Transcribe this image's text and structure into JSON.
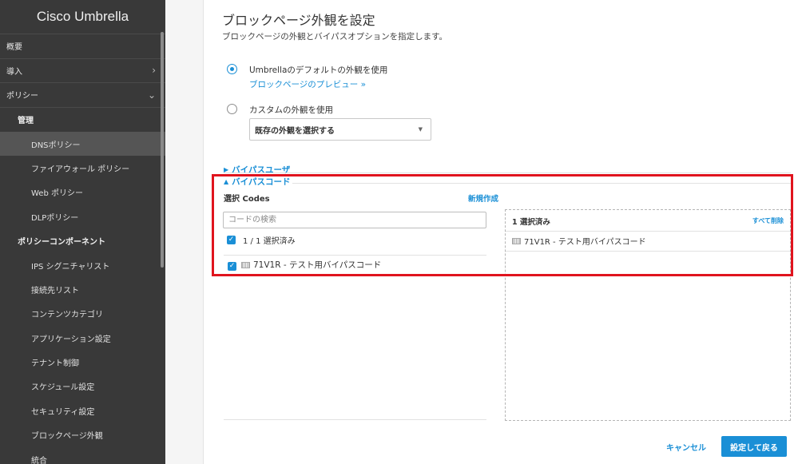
{
  "sidebar": {
    "brand": "Cisco Umbrella",
    "items": [
      {
        "label": "概要"
      },
      {
        "label": "導入",
        "chevron": "›"
      },
      {
        "label": "ポリシー",
        "chevron": "⌄"
      }
    ],
    "group_manage": "管理",
    "manage_items": [
      "DNSポリシー",
      "ファイアウォール ポリシー",
      "Web ポリシー",
      "DLPポリシー"
    ],
    "group_components": "ポリシーコンポーネント",
    "component_items": [
      "IPS シグニチャリスト",
      "接続先リスト",
      "コンテンツカテゴリ",
      "アプリケーション設定",
      "テナント制御",
      "スケジュール設定",
      "セキュリティ設定",
      "ブロックページ外観",
      "統合"
    ],
    "active": "DNSポリシー"
  },
  "main": {
    "title": "ブロックページ外観を設定",
    "subtitle": "ブロックページの外観とバイパスオプションを指定します。",
    "option_default": {
      "label": "Umbrellaのデフォルトの外観を使用",
      "preview_link": "ブロックページのプレビュー »",
      "selected": true
    },
    "option_custom": {
      "label": "カスタムの外観を使用",
      "select_value": "既存の外観を選択する",
      "selected": false
    },
    "bypass_users": "バイパスユーザ",
    "bypass_codes": "バイパスコード",
    "codes": {
      "title": "選択 Codes",
      "new_link": "新規作成",
      "search_placeholder": "コードの検索",
      "count_label": "1 / 1 選択済み",
      "items": [
        "71V1R - テスト用バイパスコード"
      ]
    },
    "selected_panel": {
      "header": "1 選択済み",
      "clear_all": "すべて削除",
      "items": [
        "71V1R - テスト用バイパスコード"
      ]
    },
    "cancel": "キャンセル",
    "save": "設定して戻る"
  },
  "colors": {
    "accent": "#1a8fd6",
    "sidebar": "#393939",
    "highlight": "#e0141e"
  }
}
